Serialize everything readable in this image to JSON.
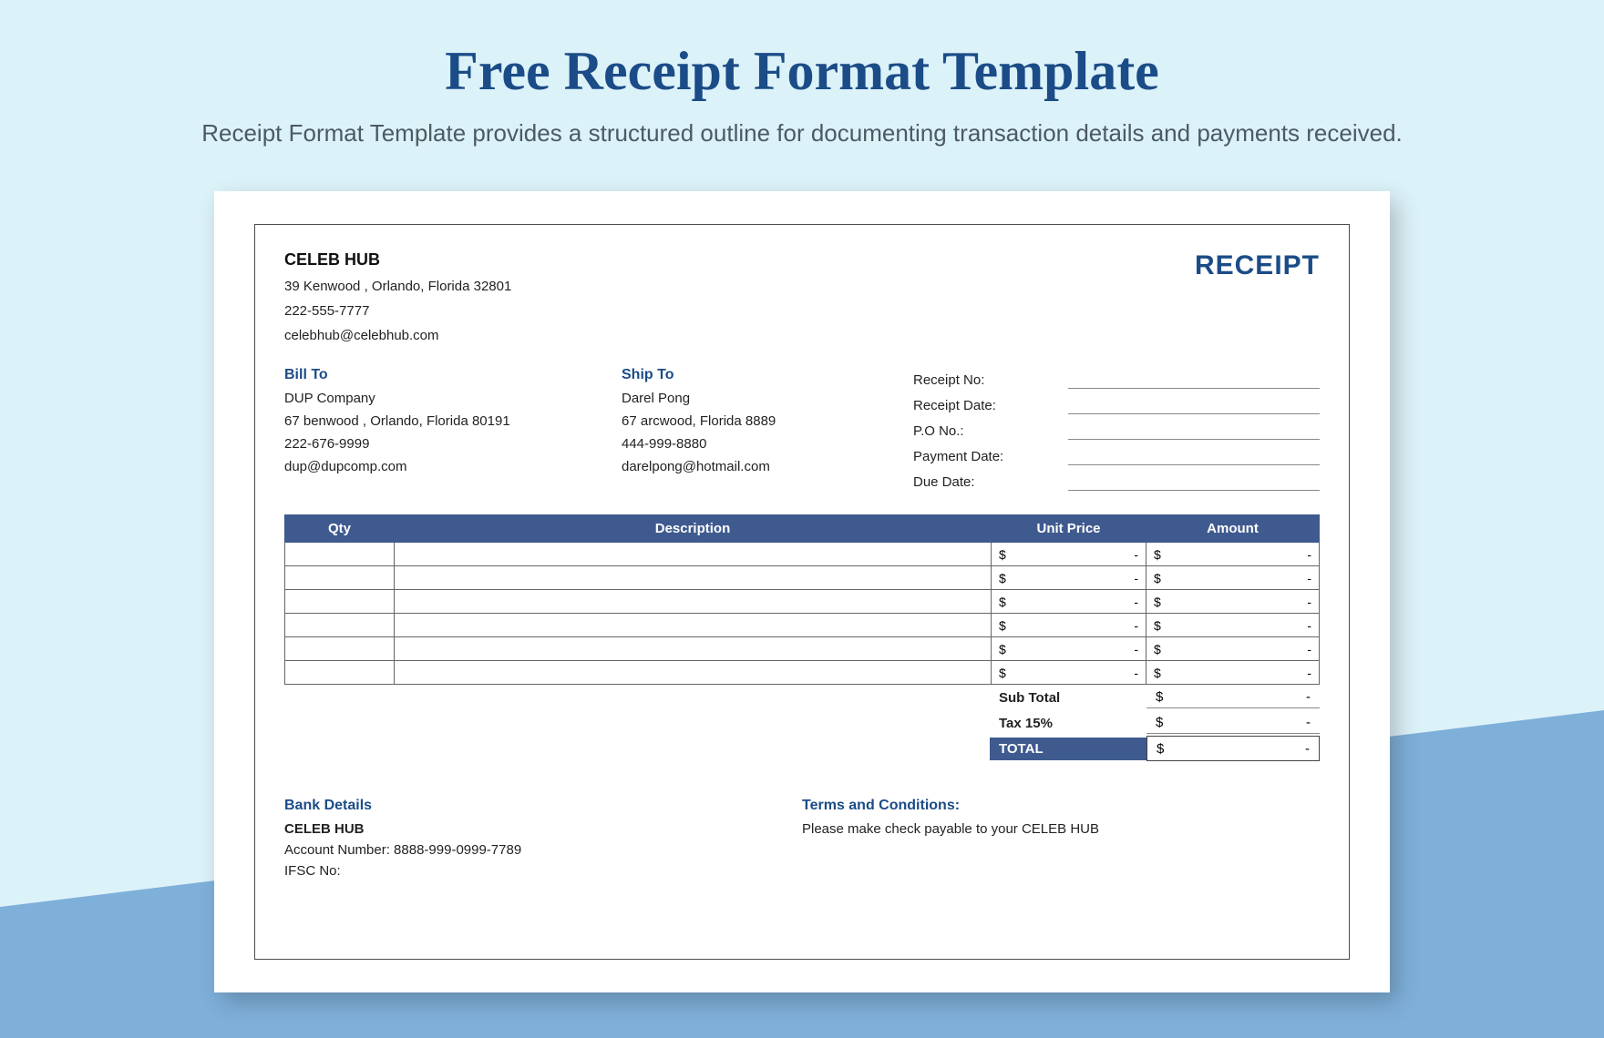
{
  "page": {
    "title": "Free Receipt Format Template",
    "subtitle": "Receipt Format Template provides a structured outline for documenting transaction details and payments received."
  },
  "company": {
    "name": "CELEB HUB",
    "address": "39 Kenwood , Orlando, Florida 32801",
    "phone": "222-555-7777",
    "email": "celebhub@celebhub.com"
  },
  "receipt_title": "RECEIPT",
  "bill_to": {
    "heading": "Bill To",
    "name": "DUP Company",
    "address": "67 benwood , Orlando, Florida 80191",
    "phone": "222-676-9999",
    "email": "dup@dupcomp.com"
  },
  "ship_to": {
    "heading": "Ship To",
    "name": "Darel Pong",
    "address": "67 arcwood, Florida 8889",
    "phone": "444-999-8880",
    "email": "darelpong@hotmail.com"
  },
  "meta_fields": [
    {
      "label": "Receipt No:"
    },
    {
      "label": "Receipt Date:"
    },
    {
      "label": "P.O No.:"
    },
    {
      "label": "Payment Date:"
    },
    {
      "label": "Due Date:"
    }
  ],
  "items_header": {
    "qty": "Qty",
    "desc": "Description",
    "uprice": "Unit Price",
    "amt": "Amount"
  },
  "items": [
    {
      "qty": "",
      "desc": "",
      "uprice_sym": "$",
      "uprice_val": "-",
      "amt_sym": "$",
      "amt_val": "-"
    },
    {
      "qty": "",
      "desc": "",
      "uprice_sym": "$",
      "uprice_val": "-",
      "amt_sym": "$",
      "amt_val": "-"
    },
    {
      "qty": "",
      "desc": "",
      "uprice_sym": "$",
      "uprice_val": "-",
      "amt_sym": "$",
      "amt_val": "-"
    },
    {
      "qty": "",
      "desc": "",
      "uprice_sym": "$",
      "uprice_val": "-",
      "amt_sym": "$",
      "amt_val": "-"
    },
    {
      "qty": "",
      "desc": "",
      "uprice_sym": "$",
      "uprice_val": "-",
      "amt_sym": "$",
      "amt_val": "-"
    },
    {
      "qty": "",
      "desc": "",
      "uprice_sym": "$",
      "uprice_val": "-",
      "amt_sym": "$",
      "amt_val": "-"
    }
  ],
  "totals": {
    "subtotal_label": "Sub Total",
    "subtotal_sym": "$",
    "subtotal_val": "-",
    "tax_label": "Tax 15%",
    "tax_sym": "$",
    "tax_val": "-",
    "total_label": "TOTAL",
    "total_sym": "$",
    "total_val": "-"
  },
  "bank": {
    "heading": "Bank Details",
    "name": "CELEB HUB",
    "account": "Account Number: 8888-999-0999-7789",
    "ifsc": "IFSC No:"
  },
  "terms": {
    "heading": "Terms and Conditions:",
    "text": "Please make check payable to your CELEB HUB"
  }
}
